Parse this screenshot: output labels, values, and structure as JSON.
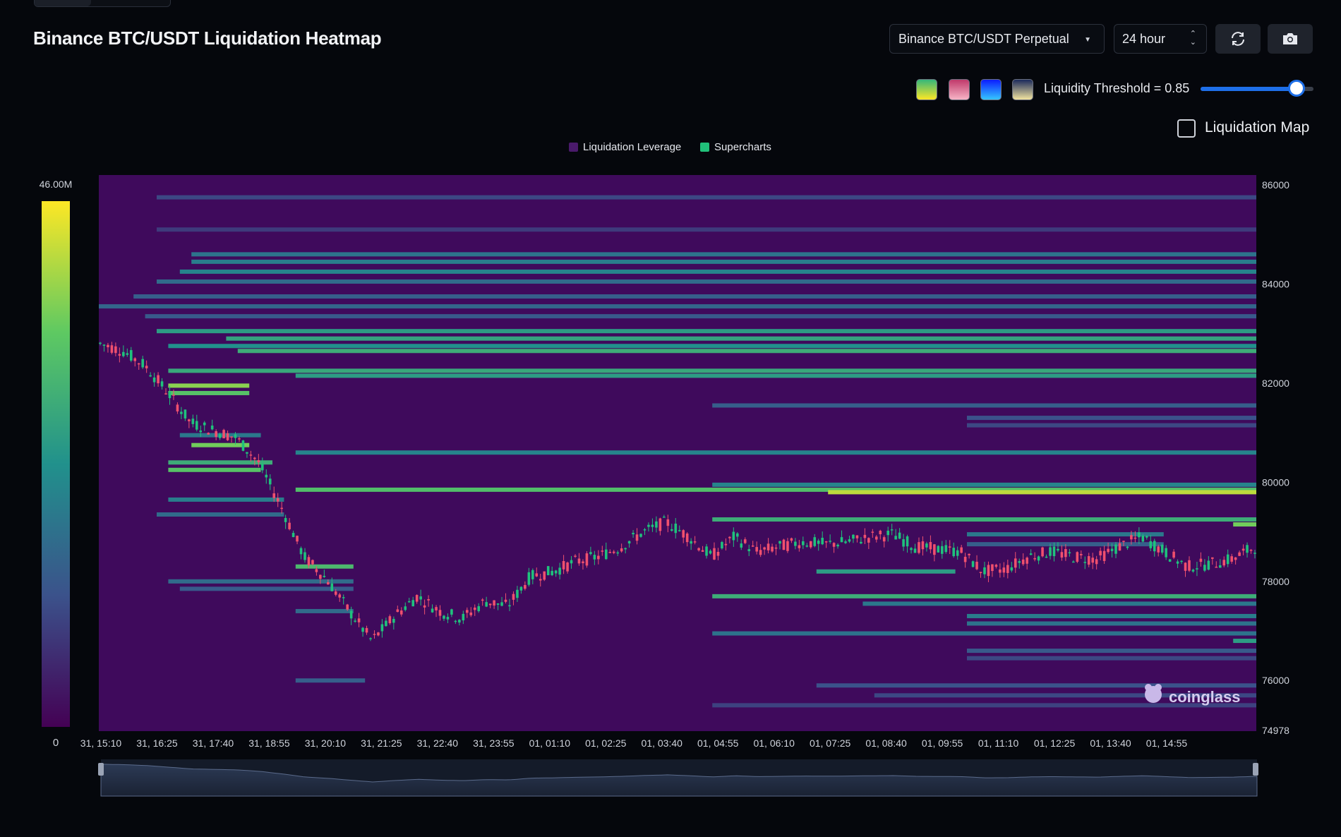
{
  "title": "Binance BTC/USDT Liquidation Heatmap",
  "controls": {
    "exchange_label": "Binance BTC/USDT Perpetual",
    "range_label": "24 hour",
    "refresh_icon": "refresh-icon",
    "camera_icon": "camera-icon",
    "threshold_label": "Liquidity Threshold = 0.85",
    "threshold_value": 0.85,
    "checkbox_label": "Liquidation Map",
    "checkbox_checked": false,
    "palettes": [
      {
        "name": "viridis",
        "colors": [
          "#35b779",
          "#fde725"
        ]
      },
      {
        "name": "pink",
        "colors": [
          "#c0396b",
          "#f7b4c6"
        ]
      },
      {
        "name": "blue",
        "colors": [
          "#0b1cff",
          "#35c6ff"
        ]
      },
      {
        "name": "gold",
        "colors": [
          "#1b2a5c",
          "#f2e4a0"
        ]
      }
    ]
  },
  "legend": {
    "items": [
      {
        "label": "Liquidation Leverage",
        "color": "#4a1a6b"
      },
      {
        "label": "Supercharts",
        "color": "#21c07a"
      }
    ]
  },
  "colorbar": {
    "max_label": "46.00M",
    "min_label": "0"
  },
  "watermark": "coinglass",
  "chart_data": {
    "type": "heatmap",
    "y_ticks": [
      "86000",
      "84000",
      "82000",
      "80000",
      "78000",
      "76000",
      "74978"
    ],
    "ylim": [
      74978,
      86200
    ],
    "x_ticks": [
      "31, 15:10",
      "31, 16:25",
      "31, 17:40",
      "31, 18:55",
      "31, 20:10",
      "31, 21:25",
      "31, 22:40",
      "31, 23:55",
      "01, 01:10",
      "01, 02:25",
      "01, 03:40",
      "01, 04:55",
      "01, 06:10",
      "01, 07:25",
      "01, 08:40",
      "01, 09:55",
      "01, 11:10",
      "01, 12:25",
      "01, 13:40",
      "01, 14:55"
    ],
    "value_range": [
      0,
      46000000
    ],
    "price_series": [
      82800,
      82650,
      82350,
      81800,
      81200,
      81050,
      80900,
      80400,
      79500,
      78500,
      78050,
      77400,
      76800,
      77300,
      77700,
      77400,
      77250,
      77600,
      77500,
      78100,
      78200,
      78400,
      78500,
      78700,
      79000,
      79200,
      78900,
      78500,
      78900,
      78600,
      78700,
      78800,
      78750,
      78800,
      78900,
      78950,
      78700,
      78650,
      78600,
      78200,
      78250,
      78500,
      78600,
      78500,
      78450,
      78700,
      78900,
      78600,
      78300,
      78350,
      78450,
      78700
    ],
    "bands": [
      {
        "price": 85750,
        "from": 0.05,
        "to": 1.0,
        "level": 0.22
      },
      {
        "price": 85100,
        "from": 0.05,
        "to": 1.0,
        "level": 0.18
      },
      {
        "price": 84600,
        "from": 0.08,
        "to": 1.0,
        "level": 0.38
      },
      {
        "price": 84450,
        "from": 0.08,
        "to": 1.0,
        "level": 0.42
      },
      {
        "price": 84250,
        "from": 0.07,
        "to": 1.0,
        "level": 0.45
      },
      {
        "price": 84050,
        "from": 0.05,
        "to": 1.0,
        "level": 0.35
      },
      {
        "price": 83750,
        "from": 0.03,
        "to": 1.0,
        "level": 0.3
      },
      {
        "price": 83550,
        "from": 0.0,
        "to": 1.0,
        "level": 0.33
      },
      {
        "price": 83350,
        "from": 0.04,
        "to": 1.0,
        "level": 0.28
      },
      {
        "price": 83050,
        "from": 0.05,
        "to": 1.0,
        "level": 0.55
      },
      {
        "price": 82900,
        "from": 0.11,
        "to": 1.0,
        "level": 0.58
      },
      {
        "price": 82750,
        "from": 0.06,
        "to": 1.0,
        "level": 0.5
      },
      {
        "price": 82650,
        "from": 0.12,
        "to": 1.0,
        "level": 0.62
      },
      {
        "price": 82250,
        "from": 0.06,
        "to": 1.0,
        "level": 0.6
      },
      {
        "price": 82150,
        "from": 0.17,
        "to": 1.0,
        "level": 0.55
      },
      {
        "price": 81950,
        "from": 0.06,
        "to": 0.13,
        "level": 0.82
      },
      {
        "price": 81800,
        "from": 0.06,
        "to": 0.13,
        "level": 0.72
      },
      {
        "price": 81550,
        "from": 0.53,
        "to": 1.0,
        "level": 0.3
      },
      {
        "price": 81300,
        "from": 0.75,
        "to": 1.0,
        "level": 0.25
      },
      {
        "price": 81150,
        "from": 0.75,
        "to": 1.0,
        "level": 0.22
      },
      {
        "price": 80950,
        "from": 0.07,
        "to": 0.14,
        "level": 0.4
      },
      {
        "price": 80750,
        "from": 0.08,
        "to": 0.13,
        "level": 0.78
      },
      {
        "price": 80600,
        "from": 0.17,
        "to": 1.0,
        "level": 0.45
      },
      {
        "price": 80400,
        "from": 0.06,
        "to": 0.15,
        "level": 0.62
      },
      {
        "price": 80250,
        "from": 0.06,
        "to": 0.14,
        "level": 0.72
      },
      {
        "price": 79950,
        "from": 0.53,
        "to": 1.0,
        "level": 0.45
      },
      {
        "price": 79850,
        "from": 0.17,
        "to": 1.0,
        "level": 0.7
      },
      {
        "price": 79800,
        "from": 0.63,
        "to": 1.0,
        "level": 0.9
      },
      {
        "price": 79650,
        "from": 0.06,
        "to": 0.16,
        "level": 0.42
      },
      {
        "price": 79350,
        "from": 0.05,
        "to": 0.16,
        "level": 0.35
      },
      {
        "price": 79250,
        "from": 0.53,
        "to": 1.0,
        "level": 0.62
      },
      {
        "price": 79150,
        "from": 0.98,
        "to": 1.0,
        "level": 0.78
      },
      {
        "price": 78950,
        "from": 0.75,
        "to": 0.92,
        "level": 0.4
      },
      {
        "price": 78750,
        "from": 0.75,
        "to": 0.92,
        "level": 0.3
      },
      {
        "price": 78300,
        "from": 0.17,
        "to": 0.22,
        "level": 0.68
      },
      {
        "price": 78200,
        "from": 0.62,
        "to": 0.74,
        "level": 0.55
      },
      {
        "price": 78000,
        "from": 0.06,
        "to": 0.22,
        "level": 0.35
      },
      {
        "price": 77850,
        "from": 0.07,
        "to": 0.22,
        "level": 0.28
      },
      {
        "price": 77700,
        "from": 0.53,
        "to": 1.0,
        "level": 0.62
      },
      {
        "price": 77550,
        "from": 0.66,
        "to": 1.0,
        "level": 0.4
      },
      {
        "price": 77400,
        "from": 0.17,
        "to": 0.22,
        "level": 0.35
      },
      {
        "price": 77300,
        "from": 0.75,
        "to": 1.0,
        "level": 0.42
      },
      {
        "price": 77150,
        "from": 0.75,
        "to": 1.0,
        "level": 0.38
      },
      {
        "price": 76950,
        "from": 0.53,
        "to": 1.0,
        "level": 0.38
      },
      {
        "price": 76800,
        "from": 0.98,
        "to": 1.0,
        "level": 0.55
      },
      {
        "price": 76600,
        "from": 0.75,
        "to": 1.0,
        "level": 0.28
      },
      {
        "price": 76450,
        "from": 0.75,
        "to": 1.0,
        "level": 0.22
      },
      {
        "price": 76000,
        "from": 0.17,
        "to": 0.23,
        "level": 0.3
      },
      {
        "price": 75900,
        "from": 0.62,
        "to": 1.0,
        "level": 0.25
      },
      {
        "price": 75700,
        "from": 0.67,
        "to": 1.0,
        "level": 0.22
      },
      {
        "price": 75500,
        "from": 0.53,
        "to": 1.0,
        "level": 0.2
      }
    ]
  }
}
